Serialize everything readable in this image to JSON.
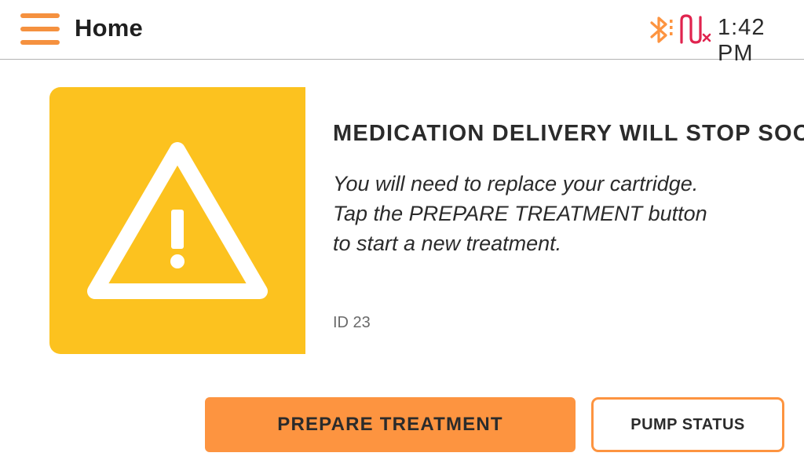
{
  "header": {
    "title": "Home",
    "time": "1:42 PM",
    "status_icons": [
      "bluetooth-icon",
      "cgm-disconnected-icon"
    ]
  },
  "alert": {
    "title": "MEDICATION DELIVERY WILL STOP SOON",
    "message_lines": [
      "You will need to replace your cartridge.",
      "Tap the PREPARE TREATMENT button",
      "to start a new treatment."
    ],
    "id_label": "ID 23",
    "icon": "warning-triangle-icon"
  },
  "buttons": {
    "primary_label": "PREPARE TREATMENT",
    "secondary_label": "PUMP STATUS"
  },
  "colors": {
    "accent_orange": "#fd9440",
    "alert_yellow": "#fcc21f",
    "cgm_red": "#e0234e",
    "divider": "#b3b3b3"
  }
}
